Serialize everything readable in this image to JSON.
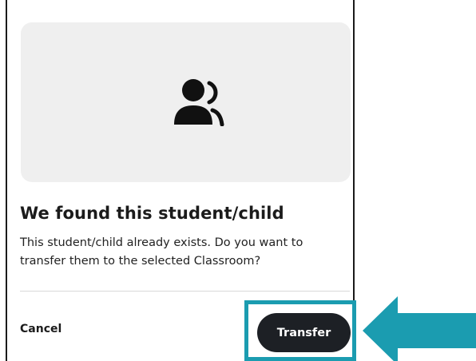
{
  "dialog": {
    "icon": "user-group-icon",
    "title": "We found this student/child",
    "message": "This student/child already exists. Do you want to transfer them to the selected Classroom?",
    "cancel_label": "Cancel",
    "transfer_label": "Transfer"
  },
  "annotation": {
    "highlight_color": "#1b9cb0",
    "arrow_icon": "arrow-left-icon"
  },
  "colors": {
    "button_dark": "#1d2025",
    "illustration_bg": "#efefef"
  }
}
